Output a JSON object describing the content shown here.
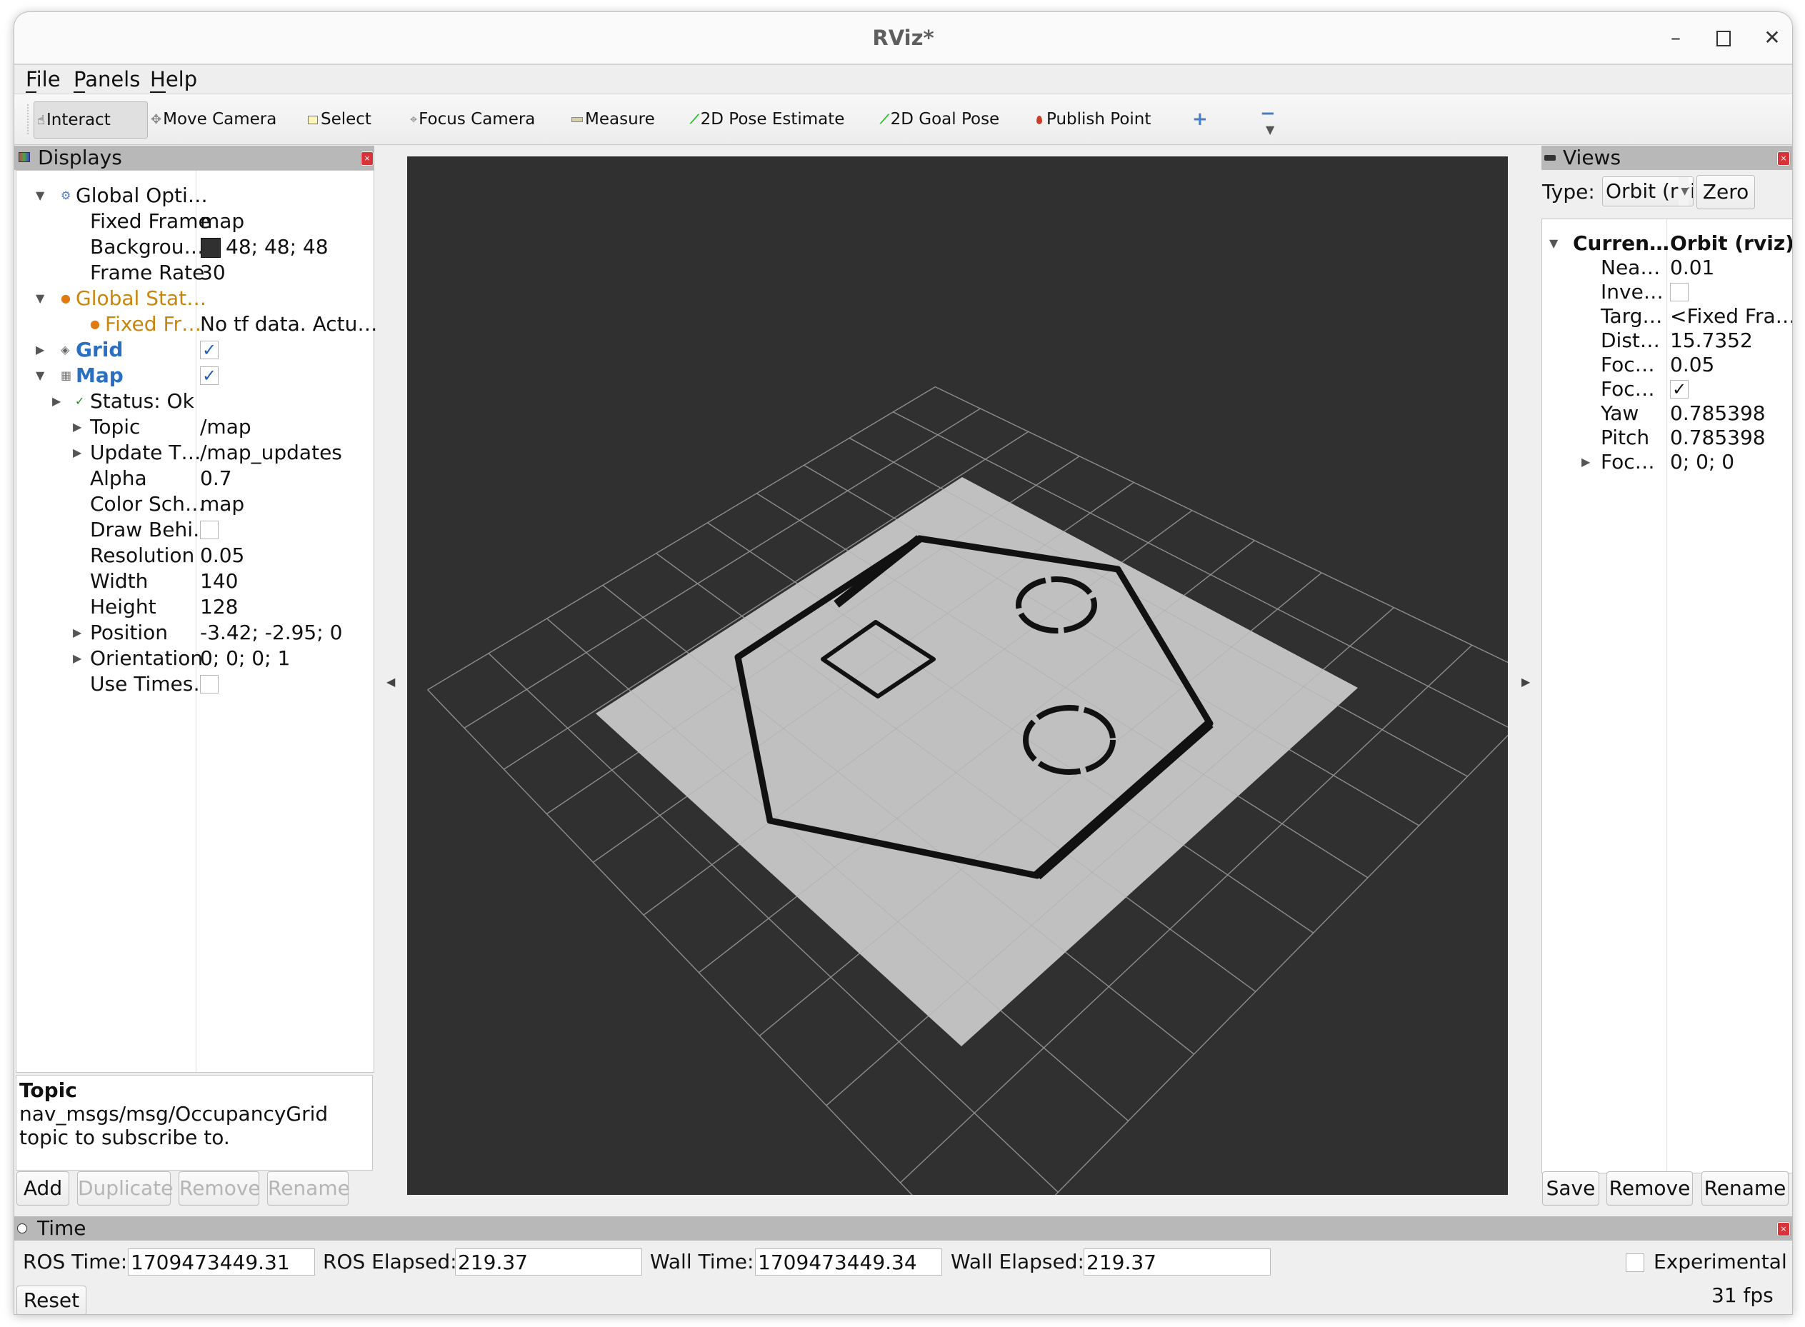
{
  "window": {
    "title": "RViz*"
  },
  "menu": [
    {
      "label": "File",
      "mnemonic": "F",
      "rest": "ile"
    },
    {
      "label": "Panels",
      "mnemonic": "P",
      "rest": "anels"
    },
    {
      "label": "Help",
      "mnemonic": "H",
      "rest": "elp"
    }
  ],
  "toolbar": {
    "tools": [
      {
        "label": "Interact",
        "icon": "hand-icon",
        "glyph": "☝",
        "active": true
      },
      {
        "label": "Move Camera",
        "icon": "move-camera-icon",
        "glyph": "✥"
      },
      {
        "label": "Select",
        "icon": "select-icon",
        "glyph": "▭"
      },
      {
        "label": "Focus Camera",
        "icon": "focus-camera-icon",
        "glyph": "⌖"
      },
      {
        "label": "Measure",
        "icon": "ruler-icon",
        "glyph": "▬"
      },
      {
        "label": "2D Pose Estimate",
        "icon": "pose-arrow-icon",
        "glyph": "⟋"
      },
      {
        "label": "2D Goal Pose",
        "icon": "goal-arrow-icon",
        "glyph": "⟋"
      },
      {
        "label": "Publish Point",
        "icon": "map-pin-icon",
        "glyph": "📍"
      }
    ],
    "add_tool": "+",
    "remove_tool": "−",
    "overflow": "▼"
  },
  "displays": {
    "title": "Displays",
    "rows": [
      {
        "name": "Global Opti…",
        "value": ""
      },
      {
        "name": "Fixed Frame",
        "value": "map"
      },
      {
        "name": "Backgrou…",
        "value": "48; 48; 48"
      },
      {
        "name": "Frame Rate",
        "value": "30"
      },
      {
        "name": "Global Stat…",
        "value": ""
      },
      {
        "name": "Fixed Fr…",
        "value": "No tf data.  Actu…"
      },
      {
        "name": "Grid",
        "value": "",
        "checked": true
      },
      {
        "name": "Map",
        "value": "",
        "checked": true
      },
      {
        "name": "Status: Ok",
        "value": ""
      },
      {
        "name": "Topic",
        "value": "/map"
      },
      {
        "name": "Update T…",
        "value": "/map_updates"
      },
      {
        "name": "Alpha",
        "value": "0.7"
      },
      {
        "name": "Color Sch…",
        "value": "map"
      },
      {
        "name": "Draw Behi…",
        "value": "",
        "checked": false
      },
      {
        "name": "Resolution",
        "value": "0.05"
      },
      {
        "name": "Width",
        "value": "140"
      },
      {
        "name": "Height",
        "value": "128"
      },
      {
        "name": "Position",
        "value": "-3.42; -2.95; 0"
      },
      {
        "name": "Orientation",
        "value": "0; 0; 0; 1"
      },
      {
        "name": "Use Times…",
        "value": "",
        "checked": false
      }
    ],
    "background_color": "#303030",
    "description": {
      "title": "Topic",
      "body": "nav_msgs/msg/OccupancyGrid topic to subscribe to."
    },
    "buttons": {
      "add": "Add",
      "duplicate": "Duplicate",
      "remove": "Remove",
      "rename": "Rename"
    }
  },
  "views": {
    "title": "Views",
    "type_label": "Type:",
    "type_value": "Orbit (rviz)",
    "zero": "Zero",
    "rows": [
      {
        "name": "Curren…",
        "value": "Orbit (rviz)"
      },
      {
        "name": "Nea…",
        "value": "0.01"
      },
      {
        "name": "Inve…",
        "value": "",
        "checked": false
      },
      {
        "name": "Targ…",
        "value": "<Fixed Fra…"
      },
      {
        "name": "Dist…",
        "value": "15.7352"
      },
      {
        "name": "Foc…",
        "value": "0.05"
      },
      {
        "name": "Foc…",
        "value": "",
        "checked": true
      },
      {
        "name": "Yaw",
        "value": "0.785398"
      },
      {
        "name": "Pitch",
        "value": "0.785398"
      },
      {
        "name": "Foc…",
        "value": "0; 0; 0"
      }
    ],
    "buttons": {
      "save": "Save",
      "remove": "Remove",
      "rename": "Rename"
    }
  },
  "time": {
    "title": "Time",
    "ros_time_label": "ROS Time:",
    "ros_time": "1709473449.31",
    "ros_elapsed_label": "ROS Elapsed:",
    "ros_elapsed": "219.37",
    "wall_time_label": "Wall Time:",
    "wall_time": "1709473449.34",
    "wall_elapsed_label": "Wall Elapsed:",
    "wall_elapsed": "219.37",
    "experimental_label": "Experimental",
    "experimental": false,
    "reset": "Reset",
    "fps": "31 fps"
  },
  "viewport": {
    "background": "#303030",
    "map_free_color": "#c0c0c0",
    "map_occupied_color": "#111111",
    "grid_color": "#777777",
    "grid_cells": 10,
    "grid_cell_size_m": 1,
    "map_origin_m": [
      -3.42,
      -2.95
    ],
    "map_size_cells": [
      140,
      128
    ],
    "map_resolution_m": 0.05
  }
}
